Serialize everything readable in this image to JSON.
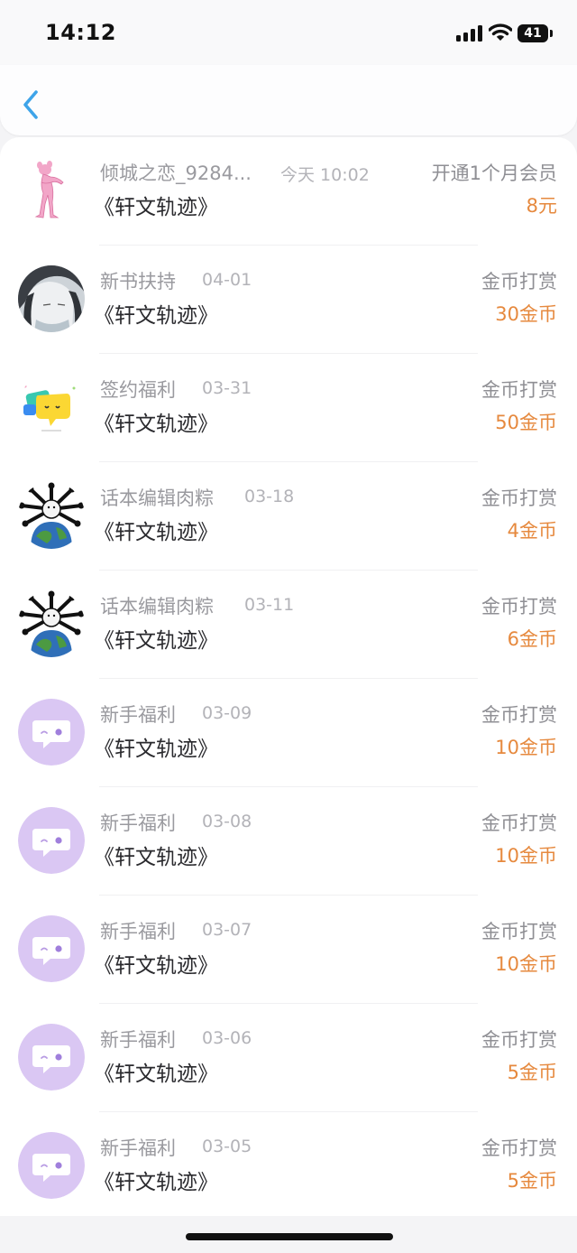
{
  "status_bar": {
    "time": "14:12",
    "battery": "41"
  },
  "colors": {
    "accent": "#3ea4e9",
    "amount": "#e6893e",
    "bot_avatar_bg": "#dac7f3"
  },
  "rows": [
    {
      "name": "倾城之恋_9284...",
      "date": "今天 10:02",
      "book": "《轩文轨迹》",
      "type": "开通1个月会员",
      "amount": "8元",
      "avatar": "pink-panther-avatar"
    },
    {
      "name": "新书扶持",
      "date": "04-01",
      "book": "《轩文轨迹》",
      "type": "金币打赏",
      "amount": "30金币",
      "avatar": "anime-character-avatar"
    },
    {
      "name": "签约福利",
      "date": "03-31",
      "book": "《轩文轨迹》",
      "type": "金币打赏",
      "amount": "50金币",
      "avatar": "yellow-chat-bubble-avatar"
    },
    {
      "name": "话本编辑肉粽",
      "date": "03-18",
      "book": "《轩文轨迹》",
      "type": "金币打赏",
      "amount": "4金币",
      "avatar": "bone-earth-avatar"
    },
    {
      "name": "话本编辑肉粽",
      "date": "03-11",
      "book": "《轩文轨迹》",
      "type": "金币打赏",
      "amount": "6金币",
      "avatar": "bone-earth-avatar"
    },
    {
      "name": "新手福利",
      "date": "03-09",
      "book": "《轩文轨迹》",
      "type": "金币打赏",
      "amount": "10金币",
      "avatar": "purple-chat-bot-avatar"
    },
    {
      "name": "新手福利",
      "date": "03-08",
      "book": "《轩文轨迹》",
      "type": "金币打赏",
      "amount": "10金币",
      "avatar": "purple-chat-bot-avatar"
    },
    {
      "name": "新手福利",
      "date": "03-07",
      "book": "《轩文轨迹》",
      "type": "金币打赏",
      "amount": "10金币",
      "avatar": "purple-chat-bot-avatar"
    },
    {
      "name": "新手福利",
      "date": "03-06",
      "book": "《轩文轨迹》",
      "type": "金币打赏",
      "amount": "5金币",
      "avatar": "purple-chat-bot-avatar"
    },
    {
      "name": "新手福利",
      "date": "03-05",
      "book": "《轩文轨迹》",
      "type": "金币打赏",
      "amount": "5金币",
      "avatar": "purple-chat-bot-avatar"
    }
  ]
}
